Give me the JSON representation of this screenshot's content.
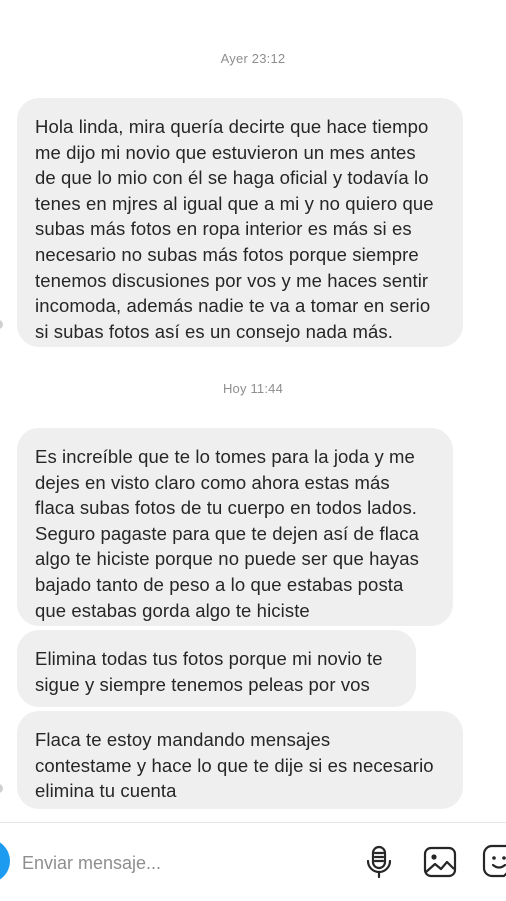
{
  "chat": {
    "timestamps": [
      "Ayer 23:12",
      "Hoy 11:44"
    ],
    "messages": [
      "Hola linda, mira quería decirte que hace tiempo\nme dijo mi novio que estuvieron un mes antes\nde que lo mio con él se haga oficial y todavía lo\ntenes en mjres al igual que a mi y no quiero que\nsubas más fotos en ropa interior es más si es\nnecesario no subas más fotos porque siempre\ntenemos discusiones por vos y me haces sentir\nincomoda, además nadie te va a tomar en serio\nsi subas fotos así es un consejo nada más.",
      "Es increíble que te lo tomes para la joda y me\ndejes en visto claro como ahora estas más\nflaca subas fotos de tu cuerpo en todos lados.\nSeguro pagaste para que te dejen así de flaca\nalgo te hiciste porque no puede ser que hayas\nbajado tanto de peso a lo que estabas posta\nque estabas gorda algo te hiciste",
      "Elimina todas tus fotos porque mi novio te\nsigue y siempre tenemos peleas por vos",
      "Flaca te estoy mandando mensajes\ncontestame y hace lo que te dije si es necesario\nelimina tu cuenta"
    ]
  },
  "composer": {
    "placeholder": "Enviar mensaje...",
    "icons": [
      "camera-icon",
      "microphone-icon",
      "gallery-icon",
      "sticker-icon"
    ]
  },
  "colors": {
    "bubble": "#efefef",
    "text": "#262626",
    "muted": "#8e8e8e",
    "accent": "#1d9bf0"
  }
}
